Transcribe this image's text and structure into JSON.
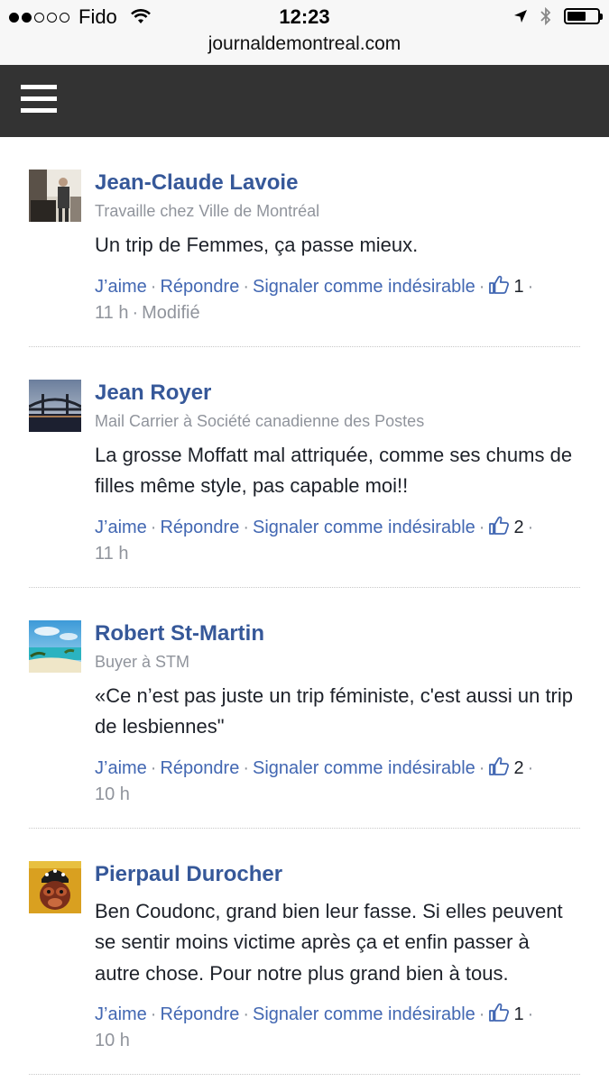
{
  "status_bar": {
    "carrier": "Fido",
    "time": "12:23",
    "url": "journaldemontreal.com"
  },
  "menu_icon": "hamburger-menu-icon",
  "actions": {
    "like": "J’aime",
    "reply": "Répondre",
    "report": "Signaler comme indésirable",
    "separator": "·"
  },
  "comments": [
    {
      "name": "Jean-Claude Lavoie",
      "job": "Travaille chez Ville de Montréal",
      "text": "Un trip de Femmes, ça passe mieux.",
      "likes": "1",
      "time": "11 h",
      "edited": "Modifié"
    },
    {
      "name": "Jean Royer",
      "job": "Mail Carrier à Société canadienne des Postes",
      "text": "La grosse Moffatt mal attriquée, comme ses chums de filles même style, pas capable moi!!",
      "likes": "2",
      "time": "11 h"
    },
    {
      "name": "Robert St-Martin",
      "job": "Buyer à STM",
      "text": "«Ce n’est pas juste un trip féministe, c'est aussi un trip de lesbiennes\"",
      "likes": "2",
      "time": "10 h"
    },
    {
      "name": "Pierpaul Durocher",
      "text": "Ben Coudonc, grand bien leur fasse. Si elles peuvent se sentir moins victime après ça et enfin passer à autre chose. Pour notre plus grand bien à tous.",
      "likes": "1",
      "time": "10 h"
    }
  ],
  "colors": {
    "name_blue": "#365899",
    "link_blue": "#4267b2",
    "nav_dark": "#333333",
    "meta_gray": "#90949c"
  }
}
